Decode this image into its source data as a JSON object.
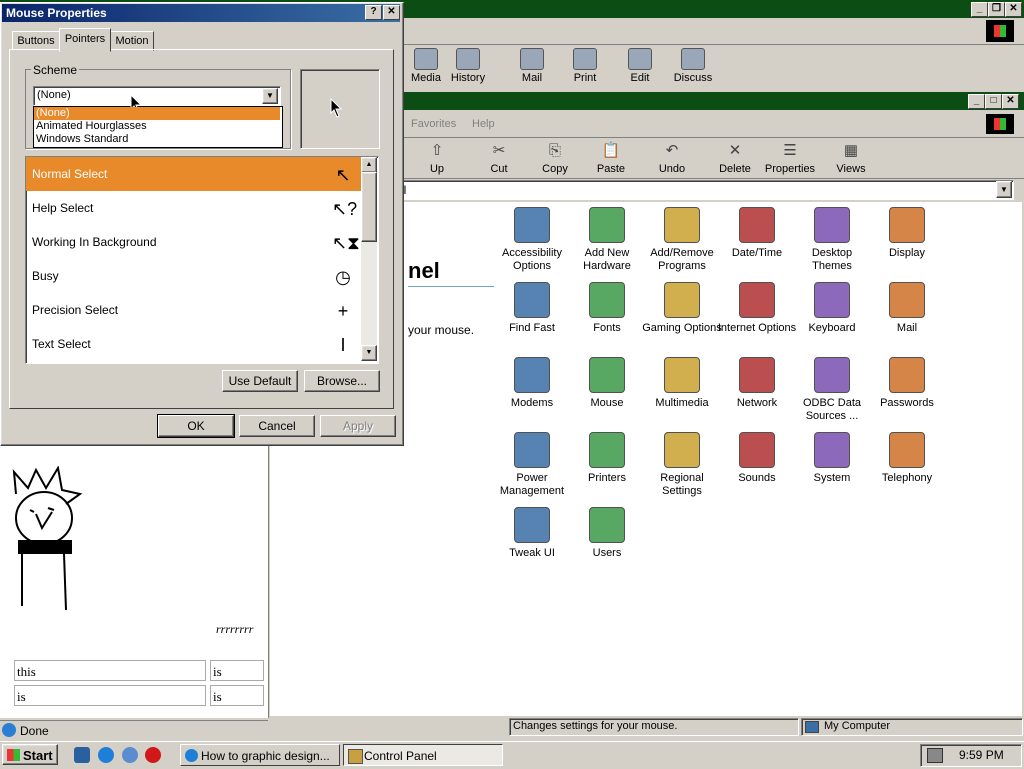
{
  "outer_window": {
    "toolbar": [
      {
        "label": "Media",
        "icon": "media-icon"
      },
      {
        "label": "History",
        "icon": "history-icon"
      },
      {
        "label": "Mail",
        "icon": "mail-icon"
      },
      {
        "label": "Print",
        "icon": "print-icon"
      },
      {
        "label": "Edit",
        "icon": "edit-icon"
      },
      {
        "label": "Discuss",
        "icon": "discuss-icon"
      }
    ]
  },
  "control_panel": {
    "menu": [
      "Favorites",
      "Help"
    ],
    "toolbar": [
      {
        "label": "Up"
      },
      {
        "label": "Cut"
      },
      {
        "label": "Copy"
      },
      {
        "label": "Paste"
      },
      {
        "label": "Undo"
      },
      {
        "label": "Delete"
      },
      {
        "label": "Properties"
      },
      {
        "label": "Views"
      }
    ],
    "address_value": "el",
    "side_title": "nel",
    "side_text": "your mouse.",
    "icons": [
      {
        "label": "Accessibility Options",
        "icon": "accessibility-icon"
      },
      {
        "label": "Add New Hardware",
        "icon": "add-hardware-icon"
      },
      {
        "label": "Add/Remove Programs",
        "icon": "add-remove-programs-icon"
      },
      {
        "label": "Date/Time",
        "icon": "date-time-icon"
      },
      {
        "label": "Desktop Themes",
        "icon": "desktop-themes-icon"
      },
      {
        "label": "Display",
        "icon": "display-icon"
      },
      {
        "label": "Find Fast",
        "icon": "find-fast-icon"
      },
      {
        "label": "Fonts",
        "icon": "fonts-icon"
      },
      {
        "label": "Gaming Options",
        "icon": "gaming-options-icon"
      },
      {
        "label": "Internet Options",
        "icon": "internet-options-icon"
      },
      {
        "label": "Keyboard",
        "icon": "keyboard-icon"
      },
      {
        "label": "Mail",
        "icon": "mail-icon"
      },
      {
        "label": "Modems",
        "icon": "modems-icon"
      },
      {
        "label": "Mouse",
        "icon": "mouse-icon"
      },
      {
        "label": "Multimedia",
        "icon": "multimedia-icon"
      },
      {
        "label": "Network",
        "icon": "network-icon"
      },
      {
        "label": "ODBC Data Sources ...",
        "icon": "odbc-icon"
      },
      {
        "label": "Passwords",
        "icon": "passwords-icon"
      },
      {
        "label": "Power Management",
        "icon": "power-management-icon"
      },
      {
        "label": "Printers",
        "icon": "printers-icon"
      },
      {
        "label": "Regional Settings",
        "icon": "regional-settings-icon"
      },
      {
        "label": "Sounds",
        "icon": "sounds-icon"
      },
      {
        "label": "System",
        "icon": "system-icon"
      },
      {
        "label": "Telephony",
        "icon": "telephony-icon"
      },
      {
        "label": "Tweak UI",
        "icon": "tweak-ui-icon"
      },
      {
        "label": "Users",
        "icon": "users-icon"
      }
    ],
    "status_text": "Changes settings for your mouse.",
    "status_zone": "My Computer"
  },
  "dialog": {
    "title": "Mouse Properties",
    "tabs": [
      "Buttons",
      "Pointers",
      "Motion"
    ],
    "scheme_label": "Scheme",
    "scheme_value": "(None)",
    "scheme_options": [
      "(None)",
      "Animated Hourglasses",
      "Windows Standard"
    ],
    "pointers": [
      {
        "label": "Normal Select",
        "glyph": "↖"
      },
      {
        "label": "Help Select",
        "glyph": "↖?"
      },
      {
        "label": "Working In Background",
        "glyph": "↖⧗"
      },
      {
        "label": "Busy",
        "glyph": "◷"
      },
      {
        "label": "Precision Select",
        "glyph": "+"
      },
      {
        "label": "Text Select",
        "glyph": "I"
      }
    ],
    "use_default": "Use Default",
    "browse": "Browse...",
    "ok": "OK",
    "cancel": "Cancel",
    "apply": "Apply"
  },
  "browser_page": {
    "doodle_text": "rrrrrrrr",
    "table": [
      [
        "this",
        "is"
      ],
      [
        "is",
        "is"
      ]
    ],
    "status": "Done"
  },
  "taskbar": {
    "start": "Start",
    "tasks": [
      "How to graphic design...",
      "Control Panel"
    ],
    "clock": "9:59 PM"
  },
  "colors": {
    "accent": "#e8892a",
    "title_active": "#0a246a",
    "title_green": "#0b4d12"
  }
}
